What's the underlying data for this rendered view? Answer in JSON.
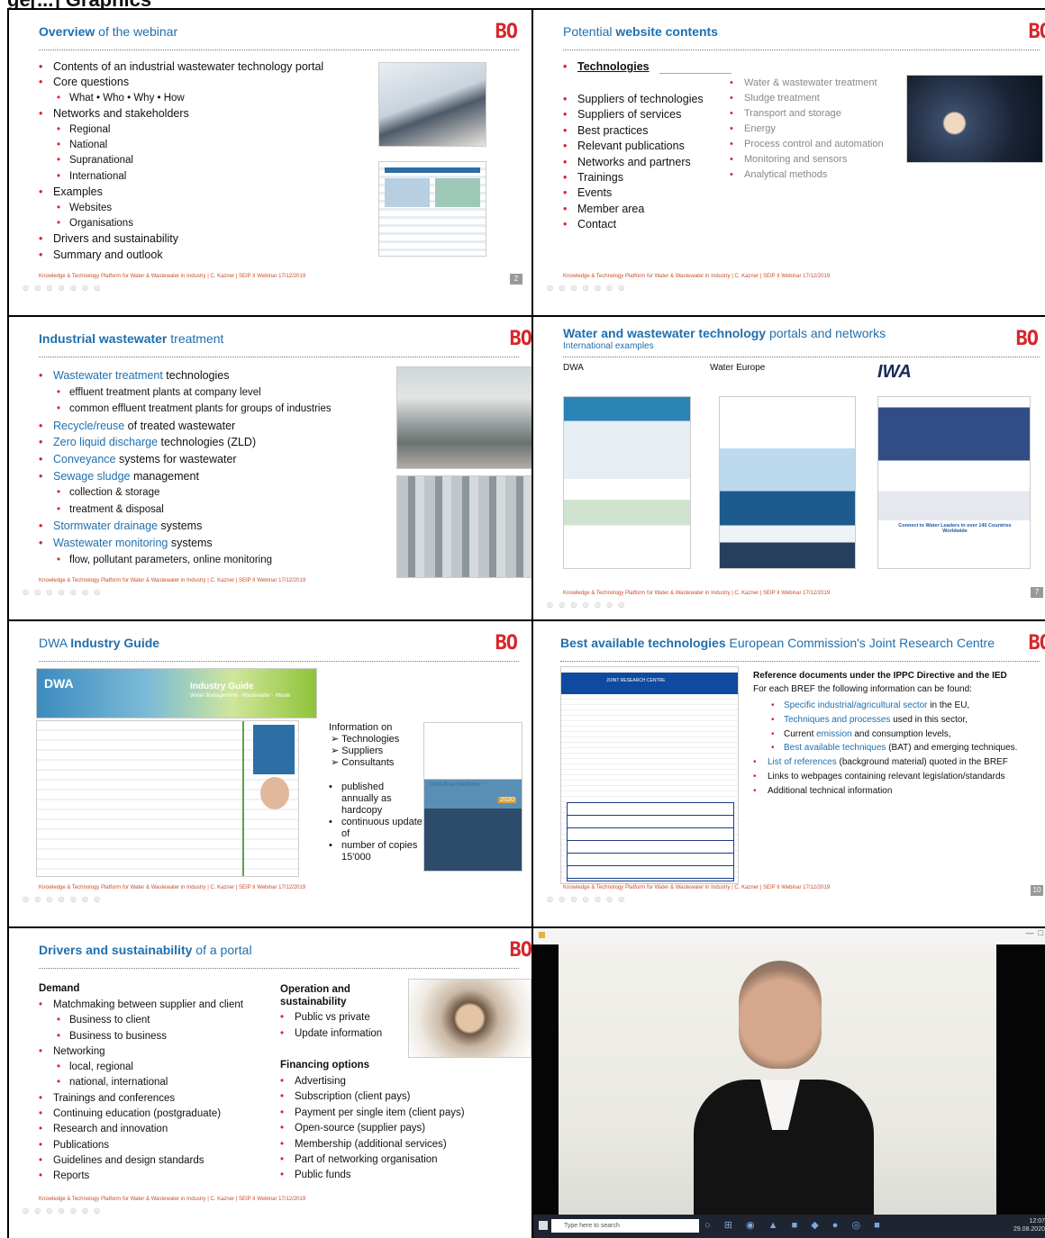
{
  "heading": "ge[...] Graphics",
  "common": {
    "footer": "Knowledge & Technology Platform for Water & Wastewater in Industry | C. Kazner | SEIP II Webinar 17/12/2019",
    "nav": "◎ ◎ ◎ ◎ ◎ ◎ ◎"
  },
  "slide1": {
    "title_bold": "Overview",
    "title_rest": " of the webinar",
    "logo": "BO",
    "page": "2",
    "items": [
      {
        "t": "Contents of an industrial wastewater technology portal",
        "lvl": 1
      },
      {
        "t": "Core questions",
        "lvl": 1
      },
      {
        "t": "What • Who • Why • How",
        "lvl": 2
      },
      {
        "t": "Networks and stakeholders",
        "lvl": 1
      },
      {
        "t": "Regional",
        "lvl": 2
      },
      {
        "t": "National",
        "lvl": 2
      },
      {
        "t": "Supranational",
        "lvl": 2
      },
      {
        "t": "International",
        "lvl": 2
      },
      {
        "t": "Examples",
        "lvl": 1
      },
      {
        "t": "Websites",
        "lvl": 2
      },
      {
        "t": "Organisations",
        "lvl": 2
      },
      {
        "t": "Drivers and sustainability",
        "lvl": 1
      },
      {
        "t": "Summary and outlook",
        "lvl": 1
      }
    ]
  },
  "slide2": {
    "title_rest": "Potential ",
    "title_bold": "website contents",
    "logo": "BO",
    "technologies": "Technologies",
    "left_items": [
      "Suppliers of technologies",
      "Suppliers of services",
      "Best practices",
      "Relevant publications",
      "Networks and partners",
      "Trainings",
      "Events",
      "Member area",
      "Contact"
    ],
    "right_items": [
      "Water & wastewater treatment",
      "Sludge treatment",
      "Transport and storage",
      "Energy",
      "Process control and automation",
      "Monitoring and sensors",
      "Analytical methods"
    ]
  },
  "slide3": {
    "title_bold": "Industrial wastewater",
    "title_rest": " treatment",
    "logo": "BO",
    "items": [
      {
        "b": "Wastewater treatment",
        "r": " technologies",
        "lvl": 1
      },
      {
        "b": "",
        "r": "effluent treatment plants at company level",
        "lvl": 2
      },
      {
        "b": "",
        "r": "common effluent treatment plants for groups of industries",
        "lvl": 2
      },
      {
        "b": "Recycle/reuse",
        "r": " of treated wastewater",
        "lvl": 1
      },
      {
        "b": "Zero liquid discharge",
        "r": " technologies (ZLD)",
        "lvl": 1
      },
      {
        "b": "Conveyance",
        "r": " systems for wastewater",
        "lvl": 1
      },
      {
        "b": "Sewage sludge",
        "r": " management",
        "lvl": 1
      },
      {
        "b": "",
        "r": "collection & storage",
        "lvl": 2
      },
      {
        "b": "",
        "r": "treatment & disposal",
        "lvl": 2
      },
      {
        "b": "Stormwater drainage",
        "r": " systems",
        "lvl": 1
      },
      {
        "b": "Wastewater monitoring",
        "r": " systems",
        "lvl": 1
      },
      {
        "b": "",
        "r": "flow, pollutant parameters, online monitoring",
        "lvl": 2
      }
    ]
  },
  "slide4": {
    "title_bold": "Water and wastewater technology",
    "title_rest": " portals and networks",
    "subtitle": "International examples",
    "logo": "BO",
    "page": "7",
    "col1": "DWA",
    "col2": "Water Europe",
    "col3": "IWA",
    "iwa_text": "Connect to Water Leaders in over 140 Countries Worldwide"
  },
  "slide5": {
    "title_rest": "DWA ",
    "title_bold": "Industry Guide",
    "logo": "BO",
    "banner_brand": "DWA",
    "banner_title": "Industry Guide",
    "banner_sub": "Water Management · Wastewater · Waste",
    "info_head": "Information on",
    "info_arrows": [
      "Technologies",
      "Suppliers",
      "Consultants"
    ],
    "info_bullets": [
      "published annually as hardcopy",
      "continuous update of",
      "number of copies 15'000"
    ],
    "book_title": "DWA-Branchenführer",
    "book_year": "2020"
  },
  "slide6": {
    "title_bold": "Best available technologies",
    "title_rest": " European Commission's Joint Research Centre",
    "logo": "BO",
    "page": "10",
    "jrc": "JOINT RESEARCH CENTRE",
    "ref_head": "Reference documents under the IPPC Directive and the IED",
    "ref_intro": "For each BREF the following information can be found:",
    "items": [
      {
        "b": "Specific industrial/agricultural sector",
        "r": " in the EU,",
        "lvl": 2
      },
      {
        "b": "Techniques and processes",
        "r": " used in this sector,",
        "lvl": 2
      },
      {
        "pre": "Current ",
        "b": "emission",
        "r": " and consumption levels,",
        "lvl": 2
      },
      {
        "b": "Best available techniques",
        "r": " (BAT) and emerging techniques.",
        "lvl": 2
      },
      {
        "b": "List of references",
        "r": " (background material) quoted in the BREF",
        "lvl": 1
      },
      {
        "b": "",
        "r": "Links to webpages containing relevant legislation/standards",
        "lvl": 1
      },
      {
        "b": "",
        "r": "Additional technical information",
        "lvl": 1
      }
    ]
  },
  "slide7": {
    "title_bold": "Drivers and sustainability",
    "title_rest": " of a portal",
    "logo": "BO",
    "demand_head": "Demand",
    "demand": [
      {
        "t": "Matchmaking between supplier and client",
        "lvl": 1
      },
      {
        "t": "Business to client",
        "lvl": 2
      },
      {
        "t": "Business to business",
        "lvl": 2
      },
      {
        "t": "Networking",
        "lvl": 1
      },
      {
        "t": "local, regional",
        "lvl": 2
      },
      {
        "t": "national, international",
        "lvl": 2
      },
      {
        "t": "Trainings and conferences",
        "lvl": 1
      },
      {
        "t": "Continuing education (postgraduate)",
        "lvl": 1
      },
      {
        "t": "Research and innovation",
        "lvl": 1
      },
      {
        "t": "Publications",
        "lvl": 1
      },
      {
        "t": "Guidelines and design standards",
        "lvl": 1
      },
      {
        "t": "Reports",
        "lvl": 1
      }
    ],
    "op_head": "Operation and sustainability",
    "op": [
      "Public vs private",
      "Update information"
    ],
    "fin_head": "Financing options",
    "fin": [
      "Advertising",
      "Subscription (client pays)",
      "Payment per single item (client pays)",
      "Open-source (supplier pays)",
      "Membership (additional services)",
      "Part of networking organisation",
      "Public funds"
    ]
  },
  "slide8": {
    "search_placeholder": "Type here to search",
    "time": "12:07",
    "date": "29.08.2020"
  }
}
